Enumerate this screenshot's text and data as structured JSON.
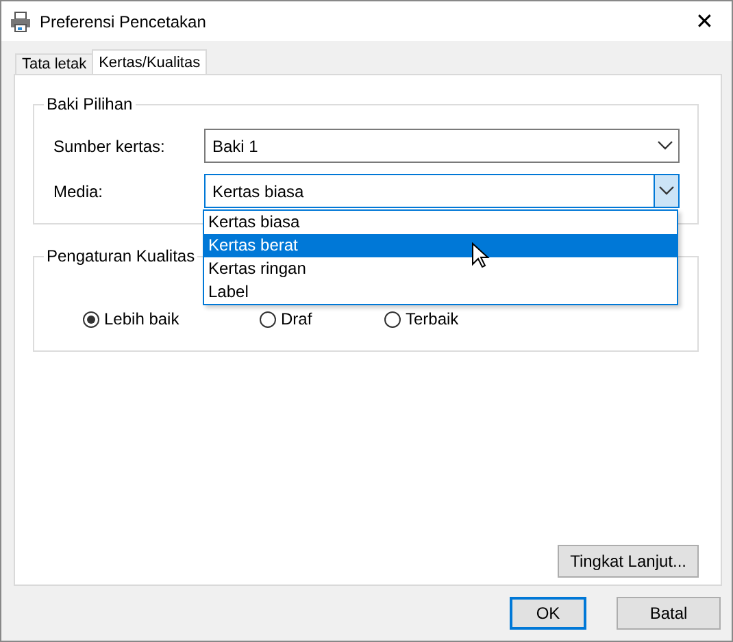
{
  "window": {
    "title": "Preferensi Pencetakan",
    "close": "✕"
  },
  "tabs": [
    {
      "label": "Tata letak",
      "selected": false
    },
    {
      "label": "Kertas/Kualitas",
      "selected": true
    }
  ],
  "tray_group": {
    "title": "Baki Pilihan",
    "fields": [
      {
        "label": "Sumber kertas:",
        "value": "Baki 1",
        "focused": false
      },
      {
        "label": "Media:",
        "value": "Kertas biasa",
        "focused": true
      }
    ],
    "media_list": [
      {
        "label": "Kertas biasa",
        "selected": false
      },
      {
        "label": "Kertas berat",
        "selected": true
      },
      {
        "label": "Kertas ringan",
        "selected": false
      },
      {
        "label": "Label",
        "selected": false
      }
    ]
  },
  "quality_group": {
    "title": "Pengaturan Kualitas",
    "options": [
      {
        "label": "Lebih baik",
        "selected": true
      },
      {
        "label": "Draf",
        "selected": false
      },
      {
        "label": "Terbaik",
        "selected": false
      }
    ]
  },
  "advanced_button": "Tingkat Lanjut...",
  "buttons": [
    {
      "label": "OK",
      "default": true
    },
    {
      "label": "Batal",
      "default": false
    }
  ]
}
